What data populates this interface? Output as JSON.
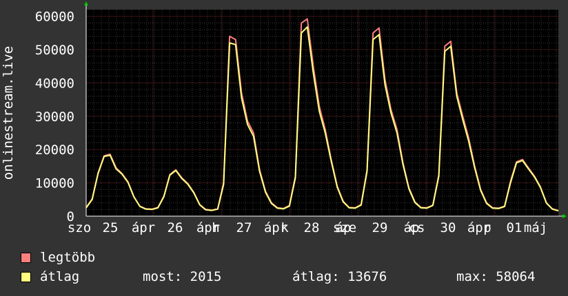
{
  "chart_data": {
    "type": "line",
    "ylabel": "onlinestream.live",
    "ylim": [
      0,
      62000
    ],
    "y_ticks": [
      "0",
      "10000",
      "20000",
      "30000",
      "40000",
      "50000",
      "60000"
    ],
    "x_tick_labels": [
      "szo",
      "25",
      "ápr",
      "26",
      "ápr",
      "h",
      "27",
      "ápr",
      "k",
      "28",
      "áp",
      "sze",
      "29",
      "áp",
      "cs",
      "30",
      "ápr",
      "p",
      "01",
      "máj"
    ],
    "grid": true,
    "series": [
      {
        "name": "legtöbb",
        "color": "#ff7f7f",
        "values": [
          2600,
          5200,
          13000,
          18100,
          18600,
          14500,
          12800,
          10300,
          5800,
          3000,
          2200,
          2100,
          2600,
          6000,
          12500,
          13900,
          11500,
          9800,
          7200,
          3500,
          2000,
          1800,
          2200,
          10000,
          54000,
          53000,
          37000,
          28500,
          25000,
          14000,
          7500,
          4000,
          2500,
          2300,
          3200,
          12000,
          58000,
          59200,
          45000,
          33000,
          26000,
          17000,
          9000,
          4500,
          2600,
          2500,
          3500,
          14000,
          55000,
          56500,
          41000,
          32000,
          26000,
          16000,
          8500,
          4300,
          2600,
          2500,
          3300,
          12500,
          51000,
          52500,
          37000,
          30000,
          23500,
          15000,
          8000,
          4000,
          2500,
          2400,
          3000,
          10500,
          16300,
          17000,
          14500,
          12000,
          8800,
          4000,
          2200,
          1700
        ]
      },
      {
        "name": "átlag",
        "color": "#ffff7f",
        "values": [
          2500,
          5000,
          12800,
          17900,
          18300,
          14200,
          12600,
          10100,
          5700,
          2900,
          2100,
          2000,
          2500,
          5800,
          12300,
          13700,
          11300,
          9600,
          7000,
          3400,
          1900,
          1700,
          2100,
          9500,
          52000,
          51500,
          35500,
          27500,
          24000,
          13500,
          7200,
          3800,
          2400,
          2200,
          3000,
          11500,
          55000,
          56800,
          43000,
          31500,
          25000,
          16500,
          8700,
          4300,
          2500,
          2400,
          3300,
          13500,
          53000,
          54500,
          39500,
          31000,
          25000,
          15500,
          8200,
          4100,
          2500,
          2400,
          3200,
          12000,
          49500,
          51000,
          36000,
          29000,
          22500,
          14500,
          7700,
          3800,
          2400,
          2300,
          2900,
          10000,
          16000,
          16700,
          14200,
          11800,
          8600,
          3900,
          2100,
          1600
        ]
      }
    ]
  },
  "legend": [
    {
      "label": "legtöbb",
      "color": "#ff7f7f"
    },
    {
      "label": "átlag",
      "color": "#ffff7f"
    }
  ],
  "stats": {
    "current": "most: 2015",
    "average": "átlag: 13676",
    "maximum": "max: 58064"
  }
}
